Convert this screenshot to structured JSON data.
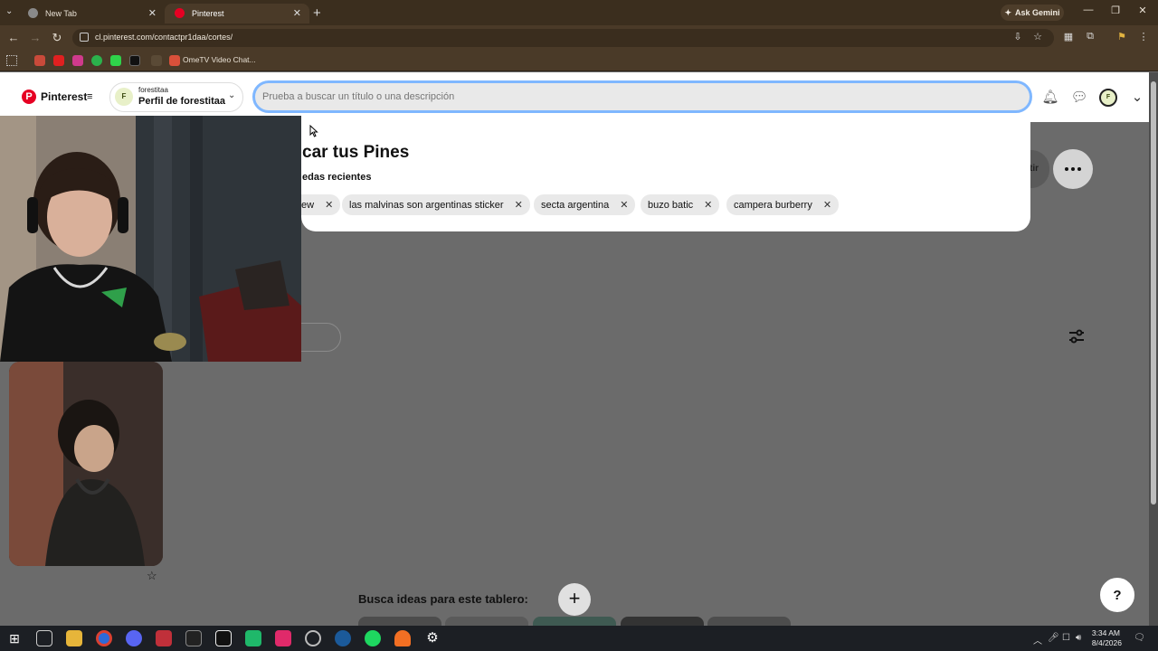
{
  "browser": {
    "tabs": [
      {
        "label": "New Tab",
        "active": false
      },
      {
        "label": "Pinterest",
        "active": true
      }
    ],
    "url": "cl.pinterest.com/contactpr1daa/cortes/",
    "gemini_label": "Ask Gemini",
    "bookmarks": {
      "ometv_label": "OmeTV Video Chat..."
    }
  },
  "pinterest": {
    "logo_text": "Pinterest",
    "profile_switcher": {
      "username": "forestitaa",
      "display": "Perfil de forestitaa",
      "initial": "F"
    },
    "search": {
      "placeholder": "Prueba a buscar un título o una descripción",
      "value": ""
    },
    "header_avatar_initial": "F",
    "dropdown": {
      "title": "car tus Pines",
      "subtitle": "edas recientes",
      "recent": [
        "ew",
        "las malvinas son argentinas sticker",
        "secta argentina",
        "buzo batic",
        "campera burberry"
      ]
    },
    "share_label": "tir",
    "ideas_label": "Busca ideas para este tablero:",
    "ideas_add": "+",
    "help": "?"
  },
  "taskbar": {
    "time": "3:34 AM",
    "date": "8/4/2026"
  },
  "colors": {
    "pinterest_red": "#e60023",
    "search_focus": "#7fb7ff",
    "chrome_bg": "#3b2e1e"
  }
}
